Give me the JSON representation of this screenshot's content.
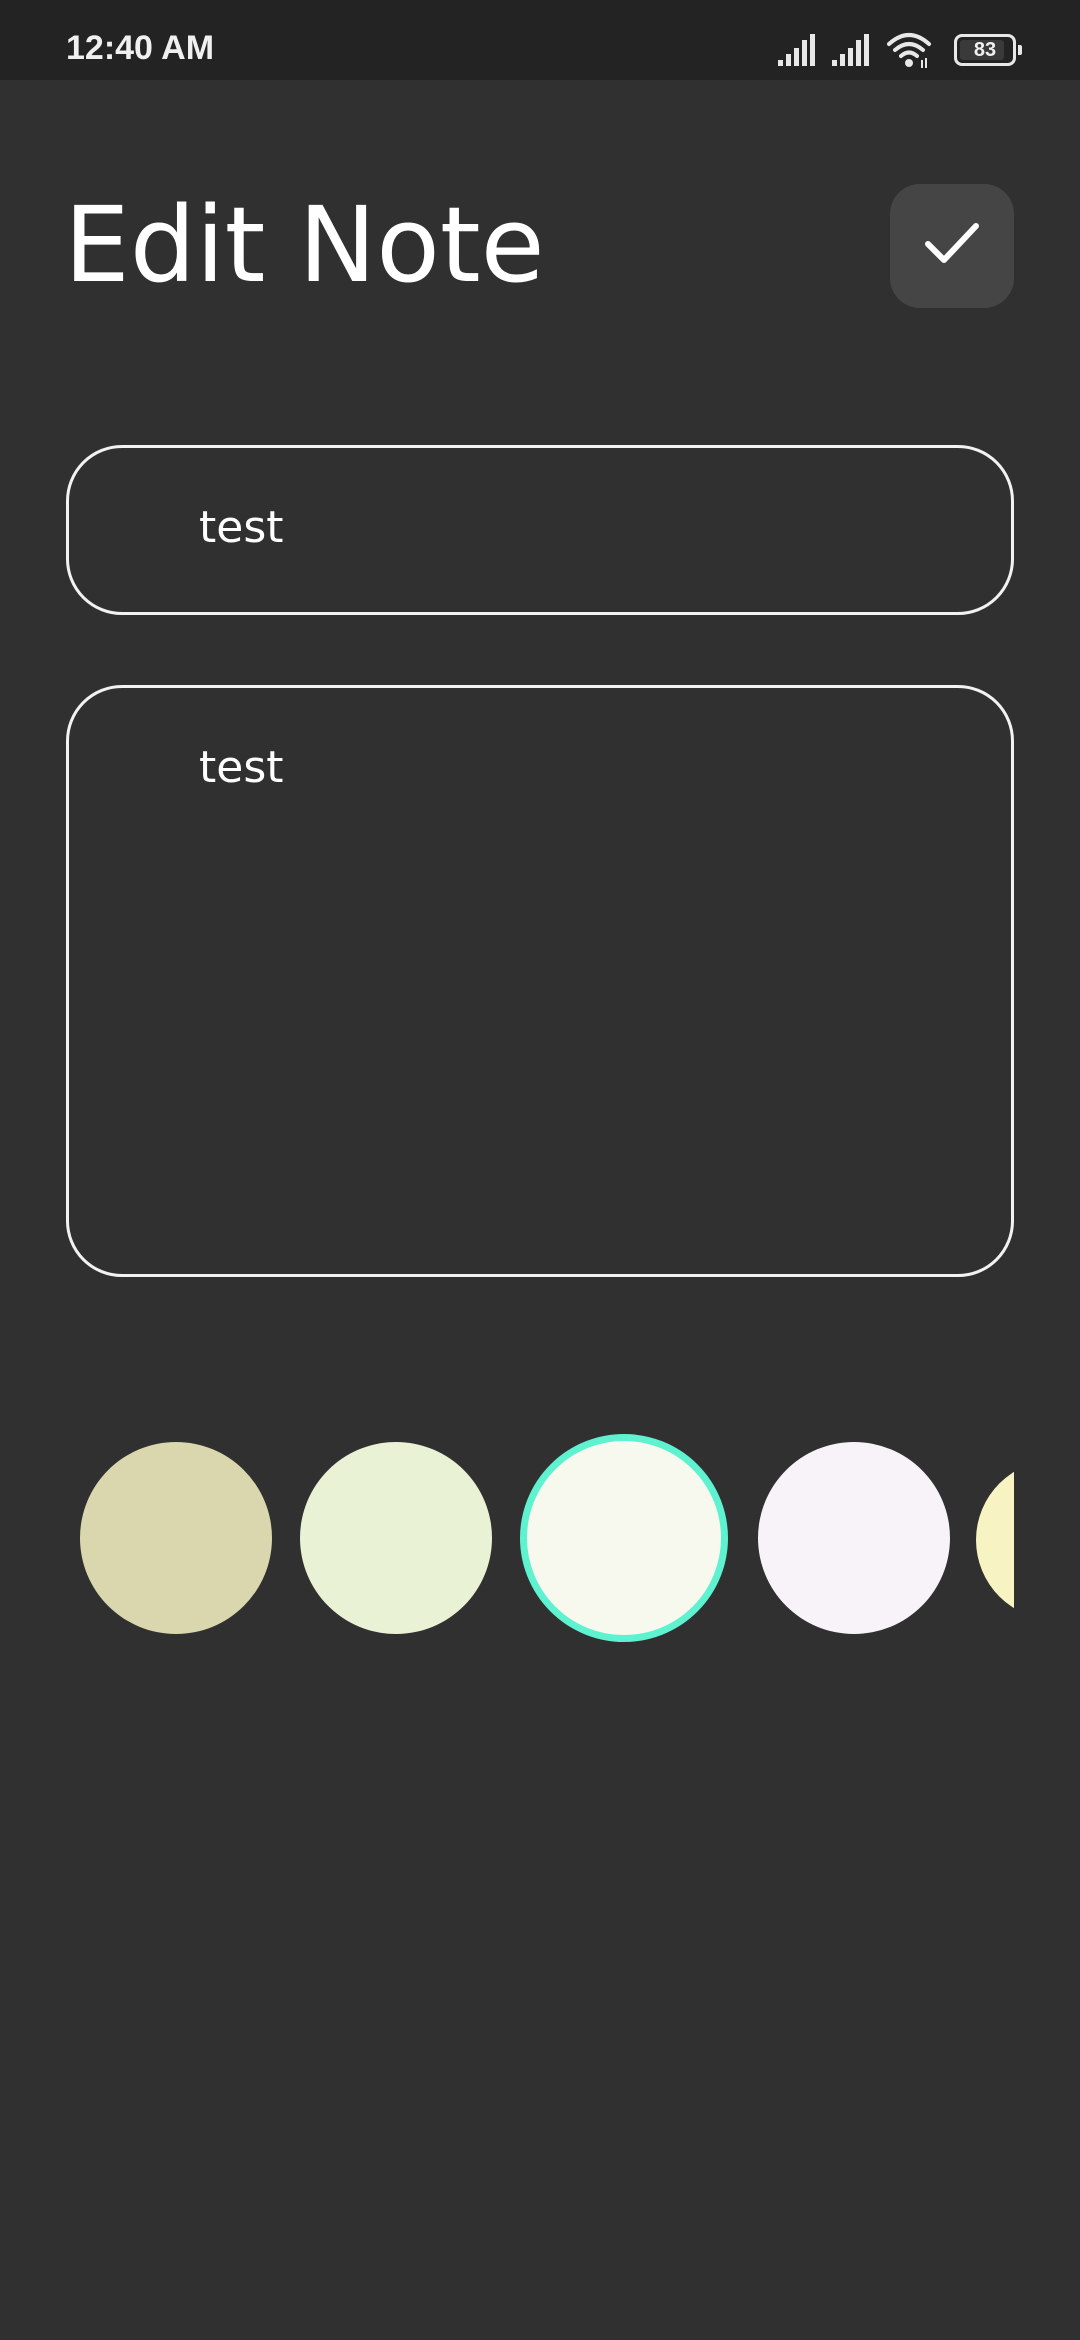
{
  "status_bar": {
    "time": "12:40 AM",
    "battery_level": "83",
    "icons": [
      "signal-icon",
      "signal-icon",
      "wifi-icon",
      "battery-icon"
    ]
  },
  "header": {
    "title": "Edit Note",
    "save_icon": "check-icon"
  },
  "note": {
    "title_value": "test",
    "content_value": "test"
  },
  "colors": {
    "accent": "#5ef2d0",
    "background": "#303030",
    "swatches": [
      {
        "color": "#dad6ad",
        "selected": false
      },
      {
        "color": "#e9f2d4",
        "selected": false
      },
      {
        "color": "#f8f9ee",
        "selected": true
      },
      {
        "color": "#f7f3f9",
        "selected": false
      },
      {
        "color": "#f8f3c2",
        "selected": false
      }
    ]
  }
}
